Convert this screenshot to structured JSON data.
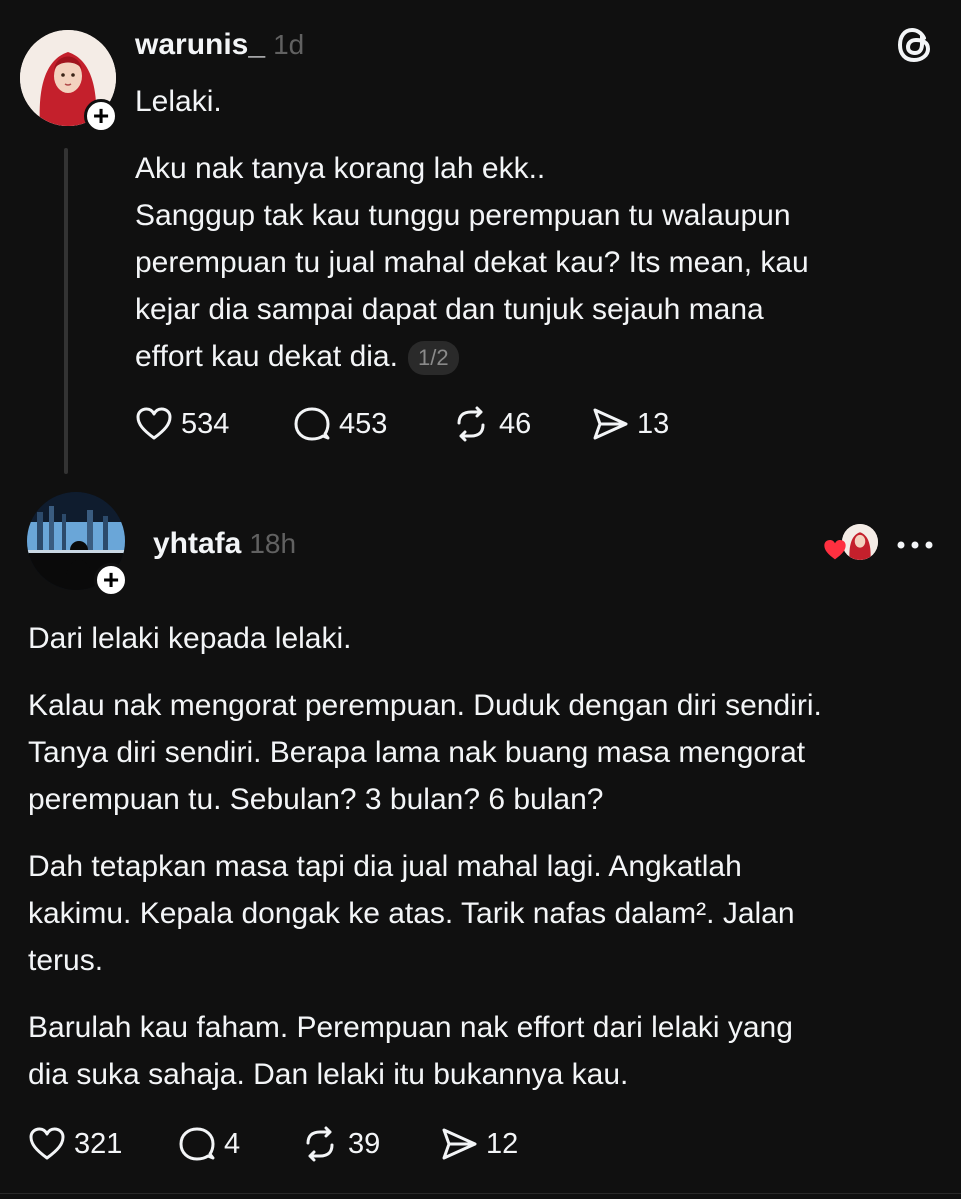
{
  "post1": {
    "username": "warunis_",
    "time": "1d",
    "title": "Lelaki.",
    "lines": [
      "Aku nak tanya korang lah ekk..",
      "Sanggup tak kau tunggu perempuan tu walaupun",
      "perempuan tu jual mahal dekat kau? Its mean, kau",
      "kejar dia sampai dapat dan tunjuk sejauh mana",
      "effort kau dekat dia."
    ],
    "page_badge": "1/2",
    "likes": "534",
    "replies": "453",
    "reposts": "46",
    "shares": "13"
  },
  "post2": {
    "username": "yhtafa",
    "time": "18h",
    "paragraphs": [
      [
        "Dari lelaki kepada lelaki."
      ],
      [
        "Kalau nak mengorat perempuan. Duduk dengan diri sendiri.",
        "Tanya diri sendiri. Berapa lama nak buang masa mengorat",
        "perempuan tu. Sebulan? 3 bulan? 6 bulan?"
      ],
      [
        "Dah tetapkan masa tapi dia jual mahal lagi. Angkatlah",
        "kakimu. Kepala dongak ke atas. Tarik nafas dalam². Jalan",
        "terus."
      ],
      [
        "Barulah kau faham. Perempuan nak effort dari lelaki yang",
        "dia suka sahaja. Dan lelaki itu bukannya kau."
      ]
    ],
    "likes": "321",
    "replies": "4",
    "reposts": "39",
    "shares": "12"
  },
  "icons": {
    "app_logo": "threads-logo-icon",
    "like": "heart-icon",
    "reply": "comment-bubble-icon",
    "repost": "repost-icon",
    "share": "send-icon",
    "more": "more-horizontal-icon",
    "follow": "plus-icon"
  },
  "colors": {
    "background": "#101010",
    "text": "#f3f5f7",
    "muted": "#616161",
    "liked_heart": "#ff3040"
  }
}
